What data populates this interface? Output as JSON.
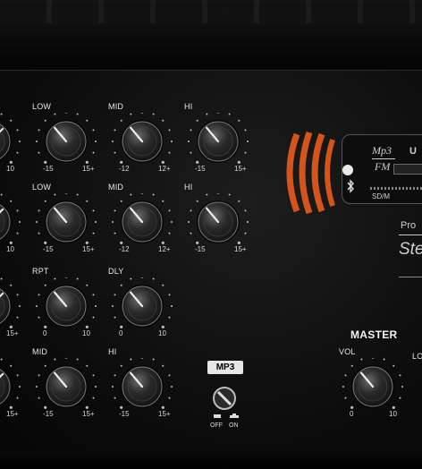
{
  "panel": {
    "knobs": [
      {
        "id": "knob-r1-partial",
        "label": "",
        "min": "",
        "max": "10",
        "angle": 45
      },
      {
        "id": "knob-r1-low",
        "label": "LOW",
        "min": "-15",
        "max": "15+",
        "angle": -40
      },
      {
        "id": "knob-r1-mid",
        "label": "MID",
        "min": "-12",
        "max": "12+",
        "angle": -40
      },
      {
        "id": "knob-r1-hi",
        "label": "HI",
        "min": "-15",
        "max": "15+",
        "angle": -40
      },
      {
        "id": "knob-r2-partial",
        "label": "",
        "min": "",
        "max": "10",
        "angle": 45
      },
      {
        "id": "knob-r2-low",
        "label": "LOW",
        "min": "-15",
        "max": "15+",
        "angle": -40
      },
      {
        "id": "knob-r2-mid",
        "label": "MID",
        "min": "-12",
        "max": "12+",
        "angle": -40
      },
      {
        "id": "knob-r2-hi",
        "label": "HI",
        "min": "-15",
        "max": "15+",
        "angle": -40
      },
      {
        "id": "knob-r3-partial",
        "label": "",
        "min": "",
        "max": "15+",
        "angle": 45
      },
      {
        "id": "knob-r3-rpt",
        "label": "RPT",
        "min": "0",
        "max": "10",
        "angle": -40
      },
      {
        "id": "knob-r3-dly",
        "label": "DLY",
        "min": "0",
        "max": "10",
        "angle": -40
      },
      {
        "id": "knob-r4-partial",
        "label": "",
        "min": "",
        "max": "15+",
        "angle": 45
      },
      {
        "id": "knob-r4-mid",
        "label": "MID",
        "min": "-15",
        "max": "15+",
        "angle": -40
      },
      {
        "id": "knob-r4-hi",
        "label": "HI",
        "min": "-15",
        "max": "15+",
        "angle": -40
      },
      {
        "id": "knob-master-vol",
        "label": "VOL",
        "min": "0",
        "max": "10",
        "angle": -40
      }
    ],
    "mp3_badge": "MP3",
    "switch_off_label": "OFF",
    "switch_on_label": "ON",
    "master_label": "MASTER",
    "right_edge_label_cut": "LO",
    "module": {
      "mp3_fm_top": "Mp3",
      "mp3_fm_bottom": "FM",
      "usb_label_cut": "U",
      "sd_label_cut": "SD/M",
      "brand_small_cut": "Pro",
      "brand_big_cut": "Ste"
    },
    "colors": {
      "accent_orange": "#d4541a",
      "panel": "#0b0b0b",
      "text": "#e8e8e8"
    }
  }
}
